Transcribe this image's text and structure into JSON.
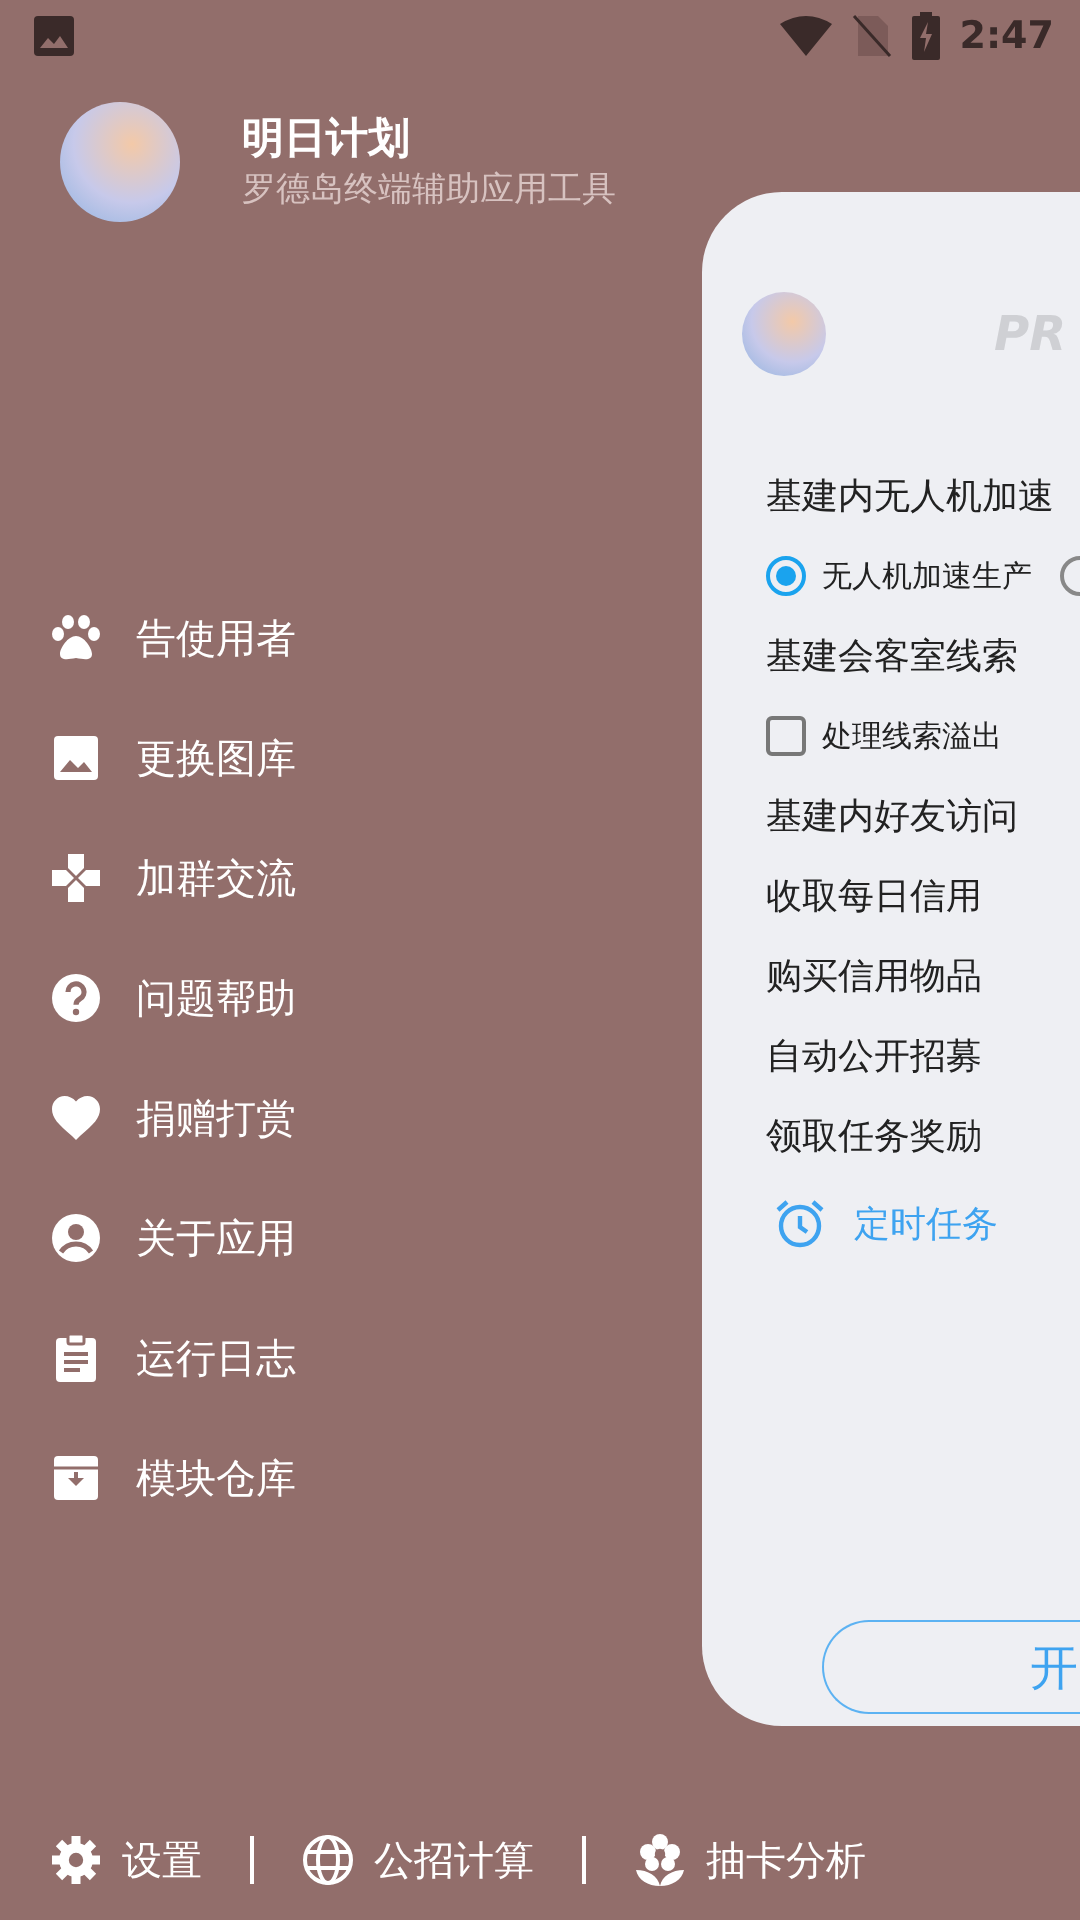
{
  "status_bar": {
    "time": "2:47"
  },
  "header": {
    "title": "明日计划",
    "subtitle": "罗德岛终端辅助应用工具"
  },
  "menu": [
    {
      "label": "告使用者"
    },
    {
      "label": "更换图库"
    },
    {
      "label": "加群交流"
    },
    {
      "label": "问题帮助"
    },
    {
      "label": "捐赠打赏"
    },
    {
      "label": "关于应用"
    },
    {
      "label": "运行日志"
    },
    {
      "label": "模块仓库"
    }
  ],
  "panel": {
    "heading": "PR",
    "tasks": [
      {
        "kind": "task",
        "label": "基建内无人机加速"
      },
      {
        "kind": "radio",
        "options": [
          {
            "label": "无人机加速生产",
            "selected": true
          },
          {
            "selected": false
          }
        ]
      },
      {
        "kind": "task",
        "label": "基建会客室线索"
      },
      {
        "kind": "checkbox",
        "label": "处理线索溢出",
        "checked": false
      },
      {
        "kind": "task",
        "label": "基建内好友访问"
      },
      {
        "kind": "task",
        "label": "收取每日信用"
      },
      {
        "kind": "task",
        "label": "购买信用物品"
      },
      {
        "kind": "task",
        "label": "自动公开招募"
      },
      {
        "kind": "task",
        "label": "领取任务奖励"
      },
      {
        "kind": "timer",
        "label": "定时任务"
      }
    ],
    "start_button": "开"
  },
  "bottom_bar": [
    {
      "label": "设置"
    },
    {
      "label": "公招计算"
    },
    {
      "label": "抽卡分析"
    }
  ]
}
